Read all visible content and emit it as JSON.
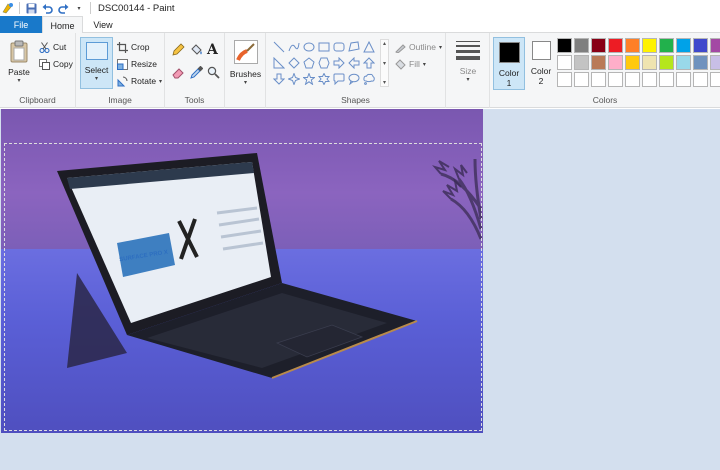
{
  "window": {
    "title": "DSC00144 - Paint"
  },
  "tabs": {
    "file": "File",
    "home": "Home",
    "view": "View"
  },
  "clipboard": {
    "paste": "Paste",
    "cut": "Cut",
    "copy": "Copy",
    "group": "Clipboard"
  },
  "image": {
    "select": "Select",
    "crop": "Crop",
    "resize": "Resize",
    "rotate": "Rotate",
    "group": "Image"
  },
  "tools": {
    "group": "Tools"
  },
  "brushes": {
    "label": "Brushes"
  },
  "shapes": {
    "outline": "Outline",
    "fill": "Fill",
    "group": "Shapes"
  },
  "size": {
    "label": "Size"
  },
  "colors": {
    "color1": "Color",
    "color1_num": "1",
    "color2": "Color",
    "color2_num": "2",
    "group": "Colors",
    "color1_value": "#000000",
    "color2_value": "#ffffff",
    "palette": [
      "#000000",
      "#7f7f7f",
      "#880015",
      "#ed1c24",
      "#ff7f27",
      "#fff200",
      "#22b14c",
      "#00a2e8",
      "#3f48cc",
      "#a349a4",
      "#ffffff",
      "#c3c3c3",
      "#b97a57",
      "#ffaec9",
      "#ffc90e",
      "#efe4b0",
      "#b5e61d",
      "#99d9ea",
      "#7092be",
      "#c8bfe7",
      "#ffffff",
      "#ffffff",
      "#ffffff",
      "#ffffff",
      "#ffffff",
      "#ffffff",
      "#ffffff",
      "#ffffff",
      "#ffffff",
      "#ffffff"
    ]
  },
  "laptop_screen": {
    "headline": "SURFACE PRO X"
  }
}
